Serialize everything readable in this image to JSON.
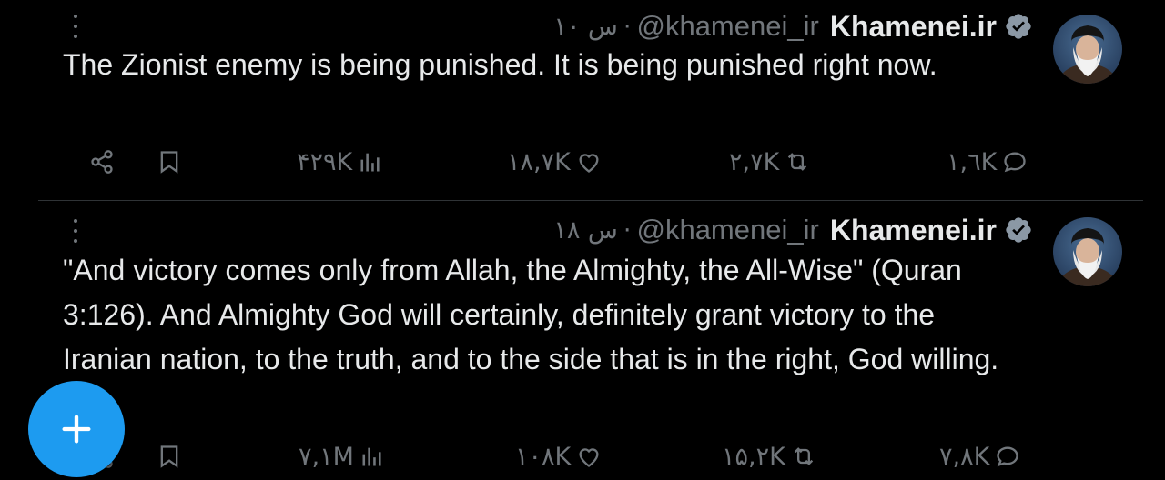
{
  "tweets": [
    {
      "name": "Khamenei.ir",
      "handle": "@khamenei_ir",
      "time": "۱۰ س",
      "text": "The Zionist enemy is being punished. It is being punished right now.",
      "views": "۴۲۹K",
      "likes": "۱۸,۷K",
      "retweets": "۲,۷K",
      "replies": "۱,٦K"
    },
    {
      "name": "Khamenei.ir",
      "handle": "@khamenei_ir",
      "time": "۱۸ س",
      "text": "\"And victory comes only from Allah, the Almighty, the All-Wise\" (Quran 3:126). And Almighty God will certainly, definitely grant victory to the Iranian nation, to the truth, and to the side that is in the right, God willing.",
      "views": "۷,۱M",
      "likes": "۱۰۸K",
      "retweets": "۱۵,۲K",
      "replies": "۷,۸K"
    }
  ],
  "colors": {
    "background": "#000000",
    "text": "#e7e9ea",
    "muted": "#71767b",
    "accent": "#1d9bf0"
  },
  "icons": [
    "share-icon",
    "bookmark-icon",
    "views-icon",
    "like-icon",
    "retweet-icon",
    "reply-icon",
    "verified-icon",
    "more-icon",
    "plus-icon"
  ]
}
